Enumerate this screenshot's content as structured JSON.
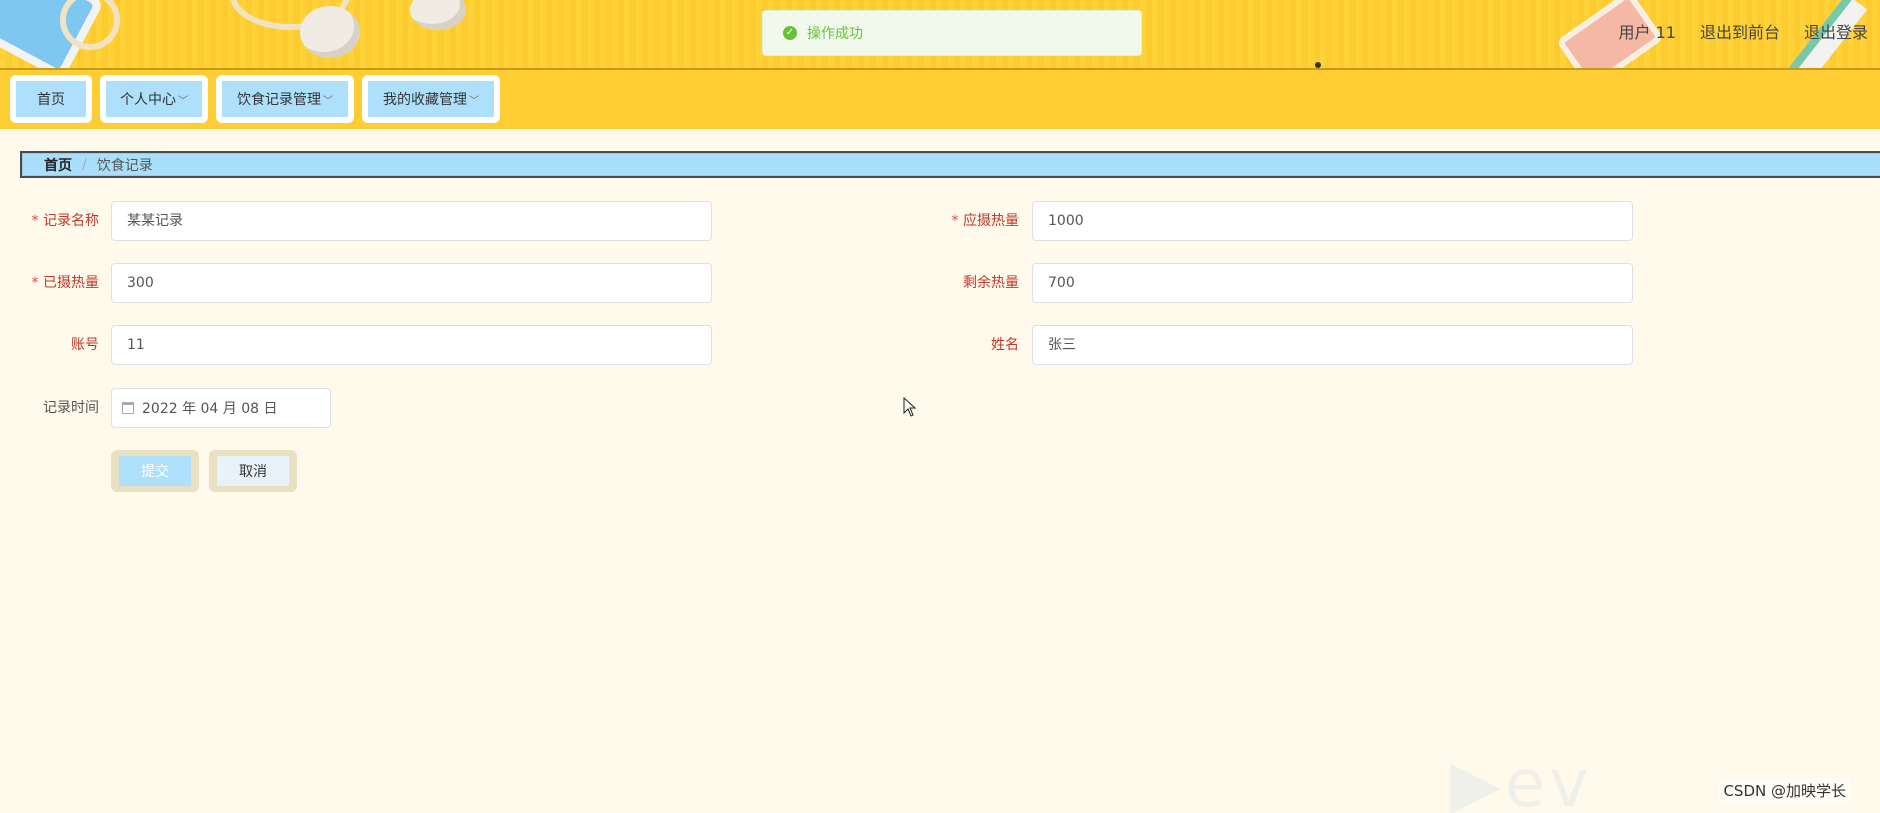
{
  "toast": {
    "message": "操作成功"
  },
  "header": {
    "user": "用户 11",
    "to_front": "退出到前台",
    "logout": "退出登录"
  },
  "nav": [
    {
      "label": "首页"
    },
    {
      "label": "个人中心"
    },
    {
      "label": "饮食记录管理"
    },
    {
      "label": "我的收藏管理"
    }
  ],
  "breadcrumb": {
    "home": "首页",
    "sep": "/",
    "current": "饮食记录"
  },
  "form": {
    "record_name": {
      "label": "记录名称",
      "value": "某某记录"
    },
    "target_calories": {
      "label": "应摄热量",
      "value": "1000"
    },
    "consumed_calories": {
      "label": "已摄热量",
      "value": "300"
    },
    "remaining_calories": {
      "label": "剩余热量",
      "value": "700"
    },
    "account": {
      "label": "账号",
      "value": "11"
    },
    "name": {
      "label": "姓名",
      "value": "张三"
    },
    "record_time": {
      "label": "记录时间",
      "value": "2022 年 04 月 08 日"
    },
    "submit_label": "提交",
    "cancel_label": "取消"
  },
  "watermark": "CSDN @加映学长",
  "colors": {
    "header_bg": "#ffd23a",
    "nav_item": "#aee0fb",
    "page_bg": "#fffaec",
    "label_red": "#c0392b",
    "success": "#67c23a"
  }
}
